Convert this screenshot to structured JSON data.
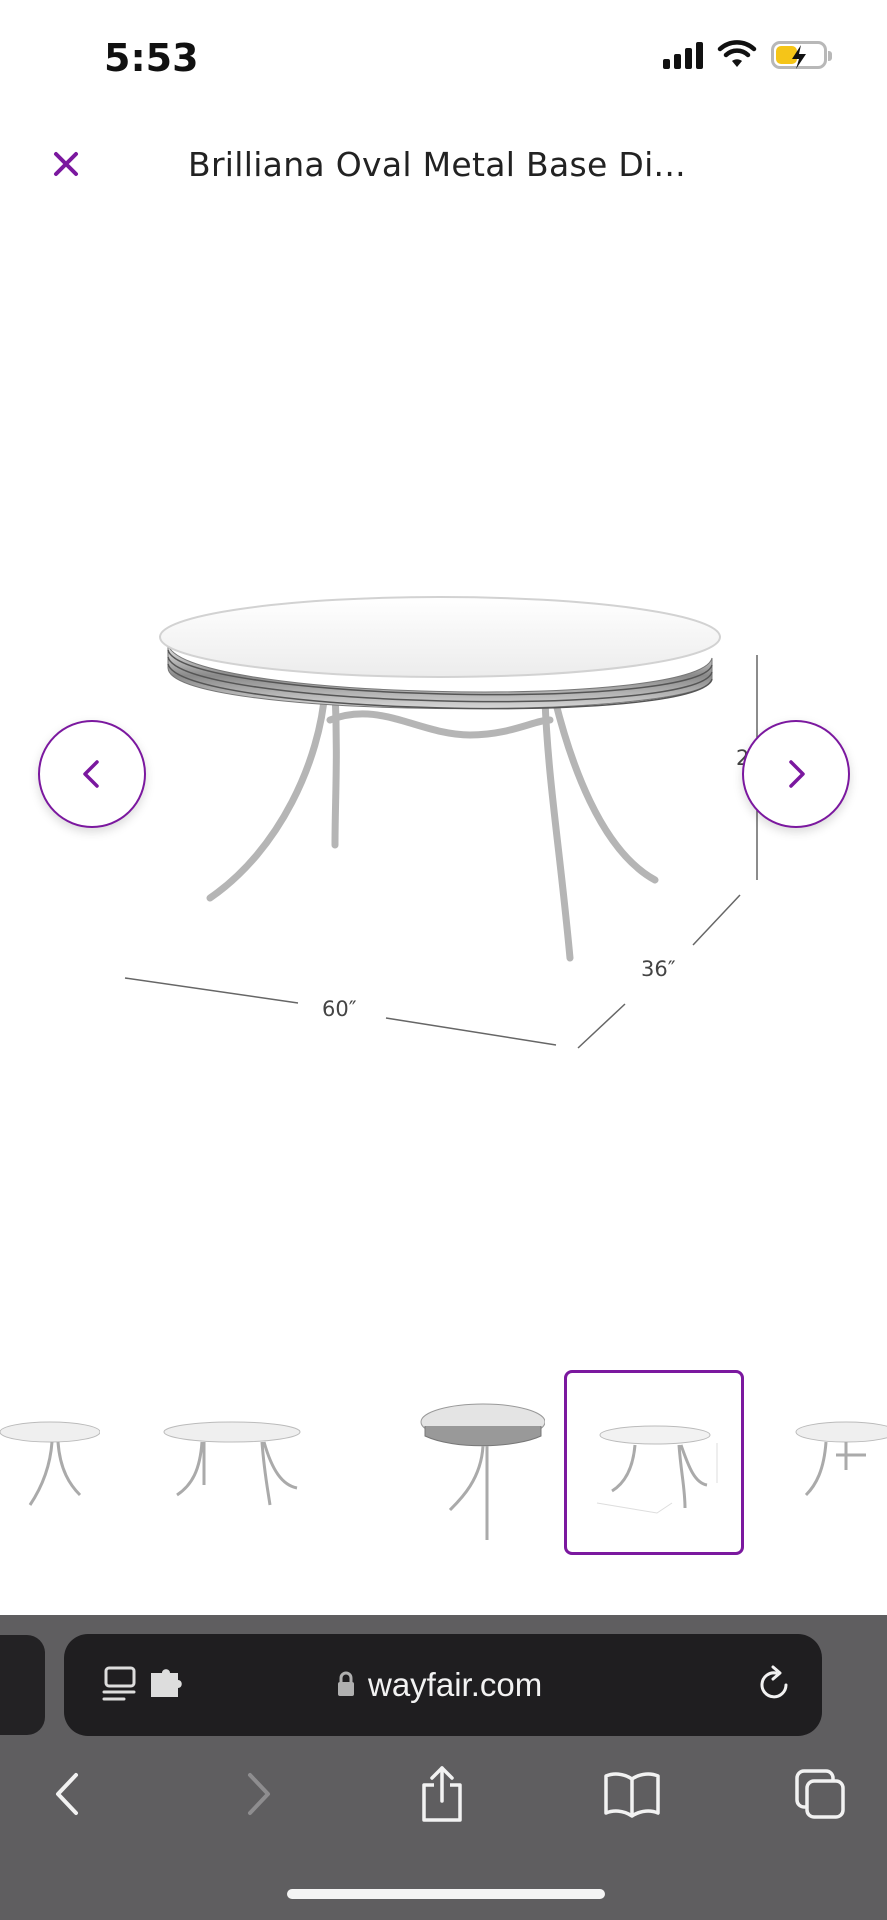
{
  "status": {
    "time": "5:53",
    "icons": [
      "signal-icon",
      "wifi-icon",
      "battery-charging-icon"
    ],
    "battery_level": 0.45
  },
  "header": {
    "title": "Brilliana Oval Metal Base Di...",
    "close_icon": "close-icon"
  },
  "product": {
    "dimensions": {
      "width": "60″",
      "depth": "36″",
      "height_partial": "2"
    }
  },
  "carousel": {
    "selected_index": 3,
    "thumb_count": 5
  },
  "browser": {
    "url": "wayfair.com",
    "icons": [
      "reader-icon",
      "extension-icon",
      "lock-icon",
      "reload-icon",
      "back-icon",
      "forward-icon",
      "share-icon",
      "bookmarks-icon",
      "tabs-icon"
    ]
  },
  "colors": {
    "accent": "#7b189f",
    "toolbar_bg": "#5f5e60",
    "url_pill_bg": "#1f1e20"
  }
}
